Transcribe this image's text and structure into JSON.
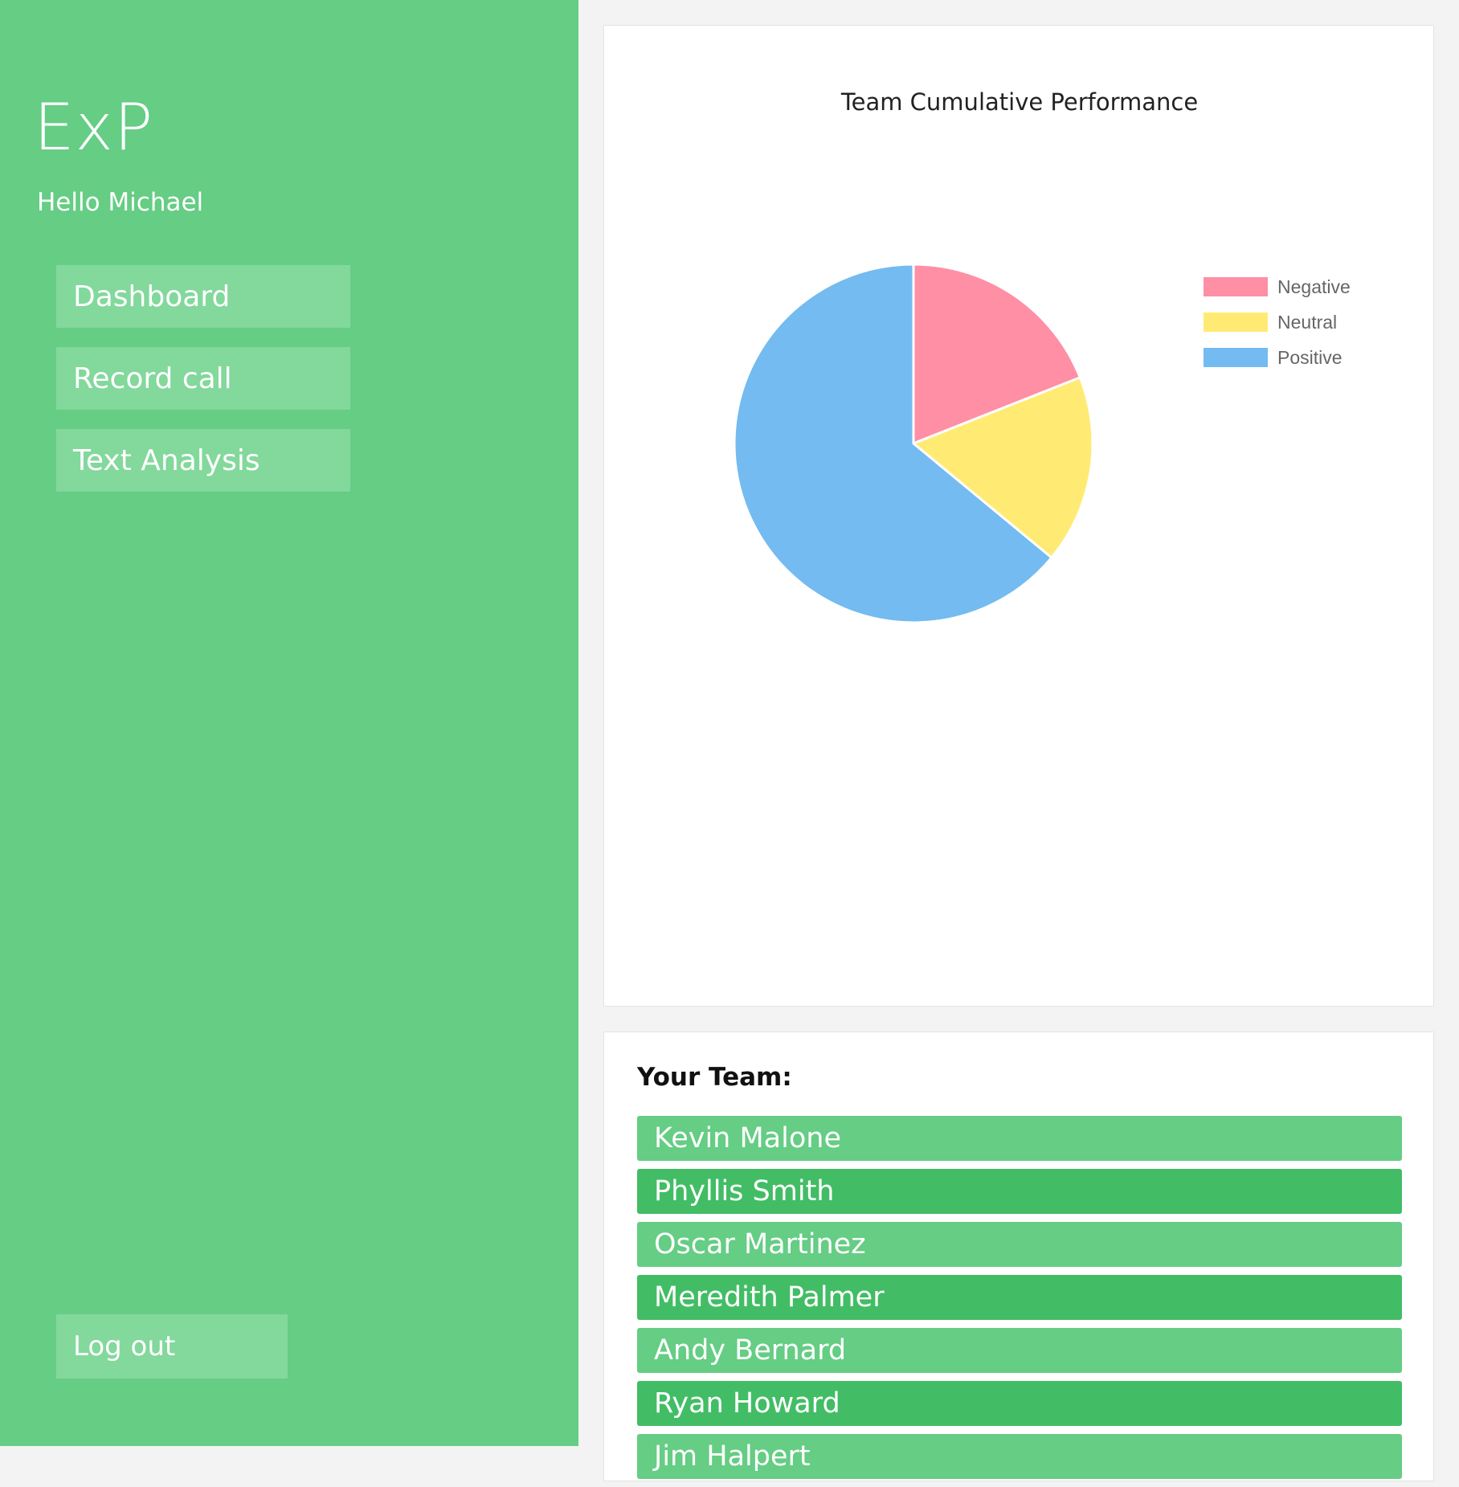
{
  "sidebar": {
    "brand": "ExP",
    "greeting": "Hello Michael",
    "nav": [
      {
        "label": "Dashboard"
      },
      {
        "label": "Record call"
      },
      {
        "label": "Text Analysis"
      }
    ],
    "logout_label": "Log out"
  },
  "team": {
    "title": "Your Team:",
    "members": [
      "Kevin Malone",
      "Phyllis Smith",
      "Oscar Martinez",
      "Meredith Palmer",
      "Andy Bernard",
      "Ryan Howard",
      "Jim Halpert"
    ]
  },
  "colors": {
    "sidebar": "#65cd84",
    "nav_button": "#83d89c",
    "row_light": "#65cd84",
    "row_dark": "#42bd65"
  },
  "chart_data": {
    "type": "pie",
    "title": "Team Cumulative Performance",
    "legend_position": "top-right",
    "categories": [
      "Negative",
      "Neutral",
      "Positive"
    ],
    "values": [
      19,
      17,
      64
    ],
    "colors": [
      "#ff8fa5",
      "#ffeb73",
      "#73bbf0"
    ]
  }
}
